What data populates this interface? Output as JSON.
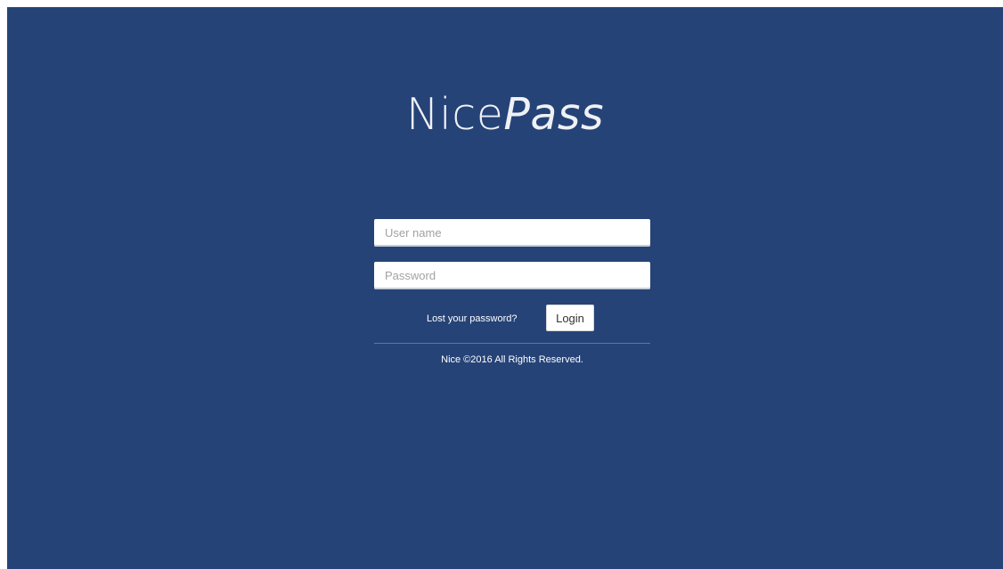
{
  "colors": {
    "background": "#254377",
    "text": "#ffffff",
    "field_background": "#ffffff",
    "placeholder": "#a2a2a2"
  },
  "logo": {
    "regular": "Nice",
    "italic": "Pass"
  },
  "form": {
    "username_placeholder": "User name",
    "password_placeholder": "Password",
    "lost_password_label": "Lost your password?",
    "login_label": "Login"
  },
  "footer": {
    "text": "Nice ©2016 All Rights Reserved."
  }
}
